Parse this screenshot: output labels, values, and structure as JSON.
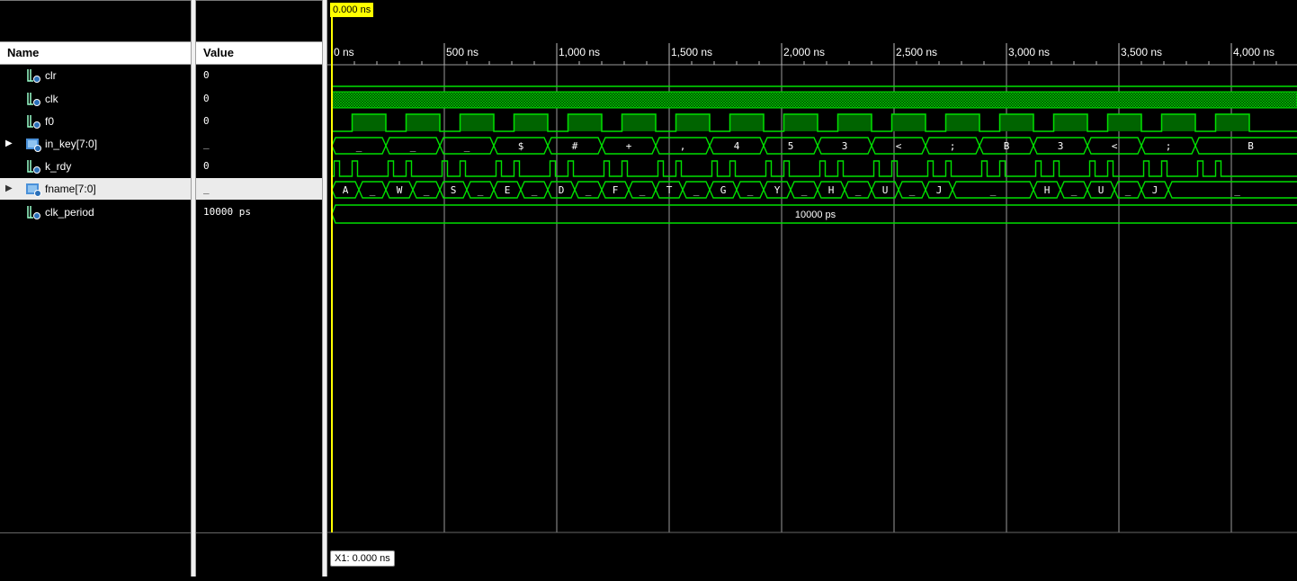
{
  "columns": {
    "name": "Name",
    "value": "Value"
  },
  "signals": [
    {
      "name": "clr",
      "value": "0",
      "kind": "bit"
    },
    {
      "name": "clk",
      "value": "0",
      "kind": "bit"
    },
    {
      "name": "f0",
      "value": "0",
      "kind": "bit"
    },
    {
      "name": "in_key[7:0]",
      "value": "_",
      "kind": "bus",
      "expandable": true
    },
    {
      "name": "k_rdy",
      "value": "0",
      "kind": "bit"
    },
    {
      "name": "fname[7:0]",
      "value": "_",
      "kind": "bus",
      "expandable": true,
      "selected": true
    },
    {
      "name": "clk_period",
      "value": "10000 ps",
      "kind": "param"
    }
  ],
  "timeline": {
    "unit": "ns",
    "ticks": [
      "0 ns",
      "500 ns",
      "1,000 ns",
      "1,500 ns",
      "2,000 ns",
      "2,500 ns",
      "3,000 ns",
      "3,500 ns",
      "4,000 ns"
    ],
    "max_ns": 4300
  },
  "cursor": {
    "label": "0.000 ns",
    "time_ns": 0
  },
  "marker": {
    "label": "X1: 0.000 ns"
  },
  "waves": {
    "clr": {
      "level": 0
    },
    "clk": {
      "type": "dense"
    },
    "f0": {
      "high_intervals_ns": [
        [
          90,
          240
        ],
        [
          330,
          480
        ],
        [
          570,
          720
        ],
        [
          810,
          960
        ],
        [
          1050,
          1200
        ],
        [
          1290,
          1440
        ],
        [
          1530,
          1680
        ],
        [
          1770,
          1920
        ],
        [
          2010,
          2160
        ],
        [
          2250,
          2400
        ],
        [
          2490,
          2640
        ],
        [
          2730,
          2880
        ],
        [
          2970,
          3120
        ],
        [
          3210,
          3360
        ],
        [
          3450,
          3600
        ],
        [
          3690,
          3840
        ],
        [
          3930,
          4080
        ]
      ]
    },
    "in_key": {
      "segments": [
        {
          "start": 0,
          "label": "_"
        },
        {
          "start": 240,
          "label": "_"
        },
        {
          "start": 480,
          "label": "_"
        },
        {
          "start": 720,
          "label": "$"
        },
        {
          "start": 960,
          "label": "#"
        },
        {
          "start": 1200,
          "label": "+"
        },
        {
          "start": 1440,
          "label": ","
        },
        {
          "start": 1680,
          "label": "4"
        },
        {
          "start": 1920,
          "label": "5"
        },
        {
          "start": 2160,
          "label": "3"
        },
        {
          "start": 2400,
          "label": "<"
        },
        {
          "start": 2640,
          "label": ";"
        },
        {
          "start": 2880,
          "label": "B"
        },
        {
          "start": 3120,
          "label": "3"
        },
        {
          "start": 3360,
          "label": "<"
        },
        {
          "start": 3600,
          "label": ";"
        },
        {
          "start": 3840,
          "label": "B"
        }
      ]
    },
    "k_rdy": {
      "pulse_pairs_start_ns": [
        10,
        250,
        490,
        730,
        970,
        1210,
        1450,
        1690,
        1930,
        2170,
        2410,
        2650,
        2890,
        3130,
        3370,
        3610,
        3850
      ]
    },
    "fname": {
      "segments": [
        {
          "start": 0,
          "label": "A"
        },
        {
          "start": 120,
          "label": "_"
        },
        {
          "start": 240,
          "label": "W"
        },
        {
          "start": 360,
          "label": "_"
        },
        {
          "start": 480,
          "label": "S"
        },
        {
          "start": 600,
          "label": "_"
        },
        {
          "start": 720,
          "label": "E"
        },
        {
          "start": 840,
          "label": "_"
        },
        {
          "start": 960,
          "label": "D"
        },
        {
          "start": 1080,
          "label": "_"
        },
        {
          "start": 1200,
          "label": "F"
        },
        {
          "start": 1320,
          "label": "_"
        },
        {
          "start": 1440,
          "label": "T"
        },
        {
          "start": 1560,
          "label": "_"
        },
        {
          "start": 1680,
          "label": "G"
        },
        {
          "start": 1800,
          "label": "_"
        },
        {
          "start": 1920,
          "label": "Y"
        },
        {
          "start": 2040,
          "label": "_"
        },
        {
          "start": 2160,
          "label": "H"
        },
        {
          "start": 2280,
          "label": "_"
        },
        {
          "start": 2400,
          "label": "U"
        },
        {
          "start": 2520,
          "label": "_"
        },
        {
          "start": 2640,
          "label": "J"
        },
        {
          "start": 2760,
          "label": "_"
        },
        {
          "start": 3120,
          "label": "H"
        },
        {
          "start": 3240,
          "label": "_"
        },
        {
          "start": 3360,
          "label": "U"
        },
        {
          "start": 3480,
          "label": "_"
        },
        {
          "start": 3600,
          "label": "J"
        },
        {
          "start": 3720,
          "label": "_"
        }
      ]
    },
    "clk_period": {
      "label": "10000 ps"
    }
  },
  "colors": {
    "wave": "#00e000",
    "grid": "#9a9a9a",
    "cursor": "#ffff00",
    "fill": "#006400"
  }
}
